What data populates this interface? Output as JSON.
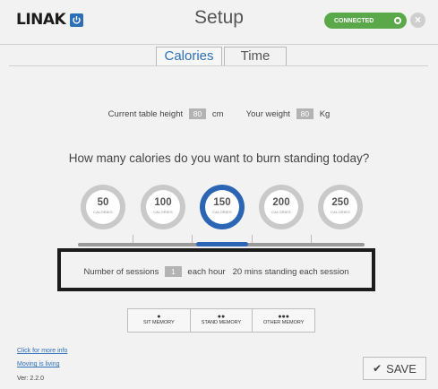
{
  "header": {
    "logo_text": "LINAK",
    "title": "Setup",
    "status_badge": "CONNECTED",
    "status_color": "#5aa84a",
    "close_icon": "close-icon"
  },
  "tabs": [
    {
      "label": "Calories",
      "active": true
    },
    {
      "label": "Time",
      "active": false
    }
  ],
  "form": {
    "height_label": "Current table height",
    "height_value": "80",
    "height_unit": "cm",
    "weight_label": "Your weight",
    "weight_value": "80",
    "weight_unit": "Kg"
  },
  "question": "How many calories do you want to burn standing today?",
  "calorie_options": [
    {
      "value": "50",
      "unit": "CALORIES",
      "selected": false
    },
    {
      "value": "100",
      "unit": "CALORIES",
      "selected": false
    },
    {
      "value": "150",
      "unit": "CALORIES",
      "selected": true
    },
    {
      "value": "200",
      "unit": "CALORIES",
      "selected": false
    },
    {
      "value": "250",
      "unit": "CALORIES",
      "selected": false
    }
  ],
  "sessions": {
    "label": "Number of sessions",
    "value": "1",
    "per": "each hour",
    "detail": "20 mins standing each session"
  },
  "memory_buttons": [
    {
      "dots": "●",
      "label": "SIT MEMORY"
    },
    {
      "dots": "●●",
      "label": "STAND MEMORY"
    },
    {
      "dots": "●●●",
      "label": "OTHER MEMORY"
    }
  ],
  "footer": {
    "link_info": "Click for more info",
    "link_moving": "Moving is living",
    "version": "Ver: 2.2.0",
    "save_label": "SAVE"
  },
  "accent_color": "#2b65b3"
}
